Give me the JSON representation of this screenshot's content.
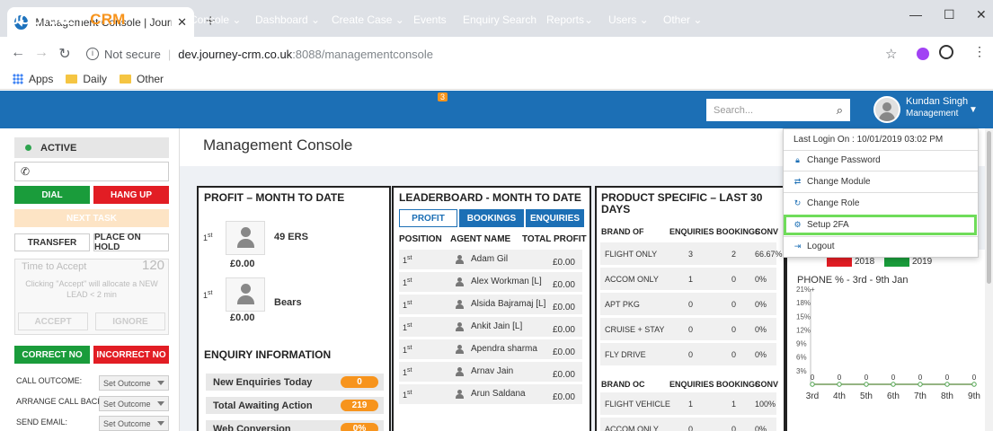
{
  "browser": {
    "tab_title": "Management Console | Journey C",
    "not_secure": "Not secure",
    "url_host": "dev.journey-crm.co.uk",
    "url_path": ":8088/managementconsole",
    "bookmarks": [
      "Apps",
      "Daily",
      "Other"
    ]
  },
  "navbar": {
    "brand_journey": "JOURNEY",
    "brand_crm": "CRM",
    "items": [
      "Console ⌄",
      "Dashboard ⌄",
      "Create Case ⌄",
      "Events",
      "Enquiry Search",
      "Reports⌄",
      "Users ⌄",
      "Other ⌄"
    ],
    "events_badge": "3",
    "search_placeholder": "Search...",
    "user_name": "Kundan Singh",
    "user_role": "Management"
  },
  "sidebar": {
    "status": "ACTIVE",
    "dial": "DIAL",
    "hang_up": "HANG UP",
    "next_task": "NEXT TASK",
    "transfer": "TRANSFER",
    "place_on_hold": "PLACE ON HOLD",
    "time_to_accept": "Time to Accept",
    "time_value": "120",
    "accept_note": "Clicking \"Accept\" will allocate a NEW LEAD < 2 min",
    "accept": "ACCEPT",
    "ignore": "IGNORE",
    "correct_no": "CORRECT NO",
    "incorrect_no": "INCORRECT NO",
    "fields": [
      {
        "label": "CALL OUTCOME:",
        "value": "Set Outcome"
      },
      {
        "label": "ARRANGE CALL BACK:",
        "value": "Set Outcome"
      },
      {
        "label": "SEND EMAIL:",
        "value": "Set Outcome"
      }
    ]
  },
  "page_title": "Management Console",
  "profit": {
    "title": "PROFIT – MONTH TO DATE",
    "rows": [
      {
        "rank": "1",
        "sup": "st",
        "team": "49 ERS",
        "value": "£0.00"
      },
      {
        "rank": "1",
        "sup": "st",
        "team": "Bears",
        "value": "£0.00"
      }
    ]
  },
  "enquiry": {
    "title": "ENQUIRY INFORMATION",
    "rows": [
      {
        "label": "New Enquiries Today",
        "value": "0"
      },
      {
        "label": "Total Awaiting Action",
        "value": "219"
      },
      {
        "label": "Web Conversion",
        "value": "0%"
      }
    ]
  },
  "leaderboard": {
    "title": "LEADERBOARD - MONTH TO DATE",
    "tabs": [
      "PROFIT",
      "BOOKINGS",
      "ENQUIRIES"
    ],
    "headers": [
      "POSITION",
      "AGENT NAME",
      "TOTAL PROFIT"
    ],
    "rows": [
      {
        "rank": "1",
        "sup": "st",
        "name": "Adam Gil",
        "profit": "£0.00"
      },
      {
        "rank": "1",
        "sup": "st",
        "name": "Alex Workman [L]",
        "profit": "£0.00"
      },
      {
        "rank": "1",
        "sup": "st",
        "name": "Alsida Bajramaj [L]",
        "profit": "£0.00"
      },
      {
        "rank": "1",
        "sup": "st",
        "name": "Ankit Jain [L]",
        "profit": "£0.00"
      },
      {
        "rank": "1",
        "sup": "st",
        "name": "Apendra sharma",
        "profit": "£0.00"
      },
      {
        "rank": "1",
        "sup": "st",
        "name": "Arnav Jain",
        "profit": "£0.00"
      },
      {
        "rank": "1",
        "sup": "st",
        "name": "Arun Saldana",
        "profit": "£0.00"
      }
    ]
  },
  "product": {
    "title_line1": "PRODUCT SPECIFIC – LAST 30",
    "title_line2": "DAYS",
    "headers1": [
      "BRAND OF",
      "ENQUIRIES",
      "BOOKINGS",
      "CONV"
    ],
    "rows1": [
      {
        "brand": "FLIGHT ONLY",
        "enq": "3",
        "book": "2",
        "conv": "66.67%"
      },
      {
        "brand": "ACCOM ONLY",
        "enq": "1",
        "book": "0",
        "conv": "0%"
      },
      {
        "brand": "APT PKG",
        "enq": "0",
        "book": "0",
        "conv": "0%"
      },
      {
        "brand": "CRUISE + STAY",
        "enq": "0",
        "book": "0",
        "conv": "0%"
      },
      {
        "brand": "FLY DRIVE",
        "enq": "0",
        "book": "0",
        "conv": "0%"
      }
    ],
    "headers2": [
      "BRAND OC",
      "ENQUIRIES",
      "BOOKINGS",
      "CONV"
    ],
    "rows2": [
      {
        "brand": "FLIGHT VEHICLE",
        "enq": "1",
        "book": "1",
        "conv": "100%"
      },
      {
        "brand": "ACCOM ONLY",
        "enq": "0",
        "book": "0",
        "conv": "0%"
      }
    ]
  },
  "user_menu": {
    "last_login": "Last Login On : 10/01/2019 03:02 PM",
    "items": [
      {
        "label": "Change Password",
        "icon": "lock-icon"
      },
      {
        "label": "Change Module",
        "icon": "exchange-icon"
      },
      {
        "label": "Change Role",
        "icon": "refresh-icon"
      },
      {
        "label": "Setup 2FA",
        "icon": "cogs-icon"
      },
      {
        "label": "Logout",
        "icon": "logout-icon"
      }
    ]
  },
  "colors": {
    "brand_blue": "#1c6fb5",
    "accent_orange": "#f7941d",
    "green": "#1a9c3b",
    "red": "#e21d24",
    "highlight": "#6fdc5a"
  },
  "chart_data": {
    "type": "line",
    "title": "PHONE % - 3rd - 9th Jan",
    "categories": [
      "3rd",
      "4th",
      "5th",
      "6th",
      "7th",
      "8th",
      "9th"
    ],
    "series": [
      {
        "name": "2018",
        "color": "#e21d24",
        "values": [
          0,
          0,
          0,
          0,
          0,
          0,
          0
        ]
      },
      {
        "name": "2019",
        "color": "#1a9c3b",
        "values": [
          0,
          0,
          0,
          0,
          0,
          0,
          0
        ]
      }
    ],
    "yticks": [
      "3%",
      "6%",
      "9%",
      "12%",
      "15%",
      "18%",
      "21%+"
    ],
    "ylim": [
      0,
      21
    ],
    "grid": false,
    "legend": "top"
  }
}
